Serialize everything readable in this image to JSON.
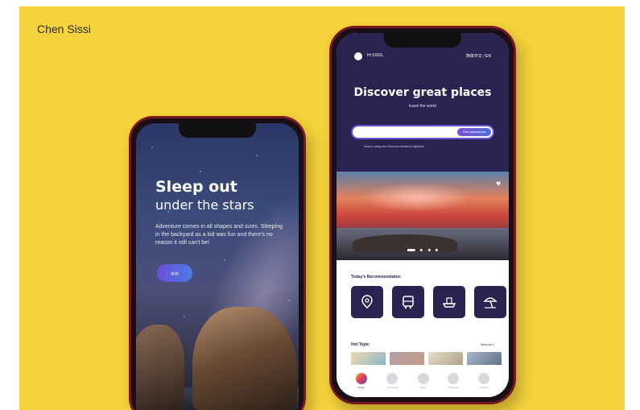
{
  "author": "Chen Sissi",
  "phone1": {
    "title": "Sleep out",
    "subtitle": "under the stars",
    "body": "Adventure comes in all shapes and sizes. Sleeping in the backyard as a kid was fun and there's no reason it still can't be!",
    "cta_label": "»»"
  },
  "phone2": {
    "greeting": "Hi SISSI,",
    "language": "简体中文 / EN",
    "title": "Discover great places",
    "subtitle": "travel the world",
    "search_button": "Find adventures",
    "search_hint": "Search categories:  Museum  Weekend  Nighttime",
    "recommendation_title": "Today's Recommendation",
    "categories": [
      {
        "name": "map-pin-icon",
        "glyph": "⌖"
      },
      {
        "name": "bus-icon",
        "glyph": "🚌"
      },
      {
        "name": "ship-icon",
        "glyph": "⛴"
      },
      {
        "name": "beach-icon",
        "glyph": "⛱"
      }
    ],
    "hot_topic_title": "Hot Topic",
    "view_all": "View all >",
    "topics": [
      "#e6cfa8",
      "#c7a48a",
      "#d9c6b0",
      "#8fa0b5"
    ],
    "nav": [
      {
        "label": "Home",
        "active": true
      },
      {
        "label": "Community",
        "active": false
      },
      {
        "label": "Order",
        "active": false
      },
      {
        "label": "Message",
        "active": false
      },
      {
        "label": "Account",
        "active": false
      }
    ]
  }
}
